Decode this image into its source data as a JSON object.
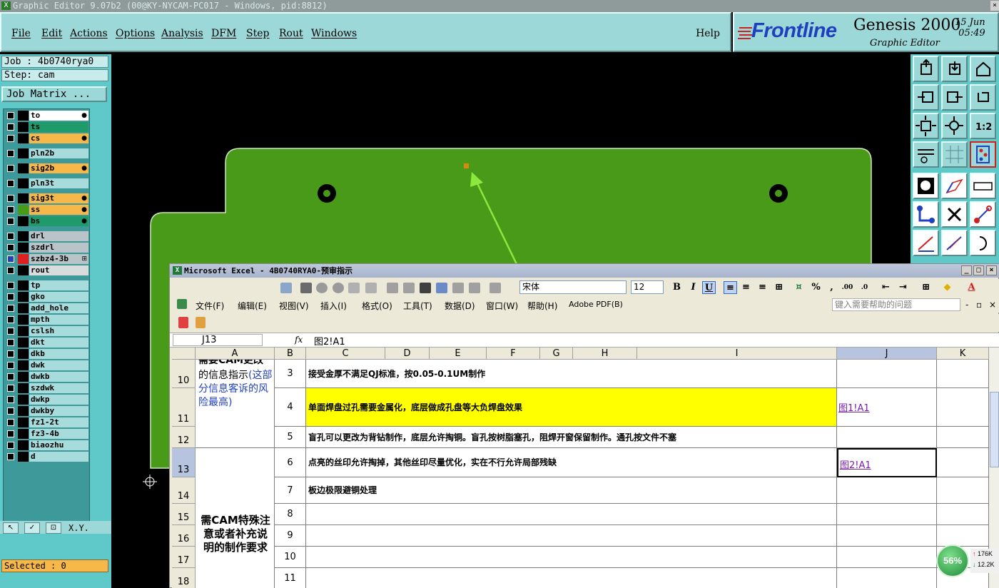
{
  "genesis": {
    "window_title": "Graphic Editor 9.07b2 (00@KY-NYCAM-PC017 - Windows, pid:8812)",
    "menu": [
      "File",
      "Edit",
      "Actions",
      "Options",
      "Analysis",
      "DFM",
      "Step",
      "Rout",
      "Windows"
    ],
    "help": "Help",
    "brand_logo": "Frontline",
    "brand_name": "Genesis 2000",
    "brand_sub": "Graphic Editor",
    "date": "15 Jun",
    "time": "05:49",
    "job": "Job : 4b0740rya0",
    "step": "Step: cam",
    "job_matrix": "Job Matrix ...",
    "selected": "Selected : 0",
    "layers": [
      {
        "name": "to",
        "color": "#ffffff",
        "mark": "●"
      },
      {
        "name": "ts",
        "color": "#1f9a6a",
        "mark": ""
      },
      {
        "name": "cs",
        "color": "#f7b84a",
        "mark": "●"
      },
      {
        "name": "pln2b",
        "color": "#a8dcdc",
        "mark": ""
      },
      {
        "name": "sig2b",
        "color": "#f7b84a",
        "mark": "●"
      },
      {
        "name": "pln3t",
        "color": "#a8dcdc",
        "mark": ""
      },
      {
        "name": "sig3t",
        "color": "#f7b84a",
        "mark": "●"
      },
      {
        "name": "ss",
        "color": "#f7b84a",
        "mark": "●"
      },
      {
        "name": "bs",
        "color": "#1f9a6a",
        "mark": "●"
      },
      {
        "name": "drl",
        "color": "#b8c4c8",
        "mark": ""
      },
      {
        "name": "szdrl",
        "color": "#b8c4c8",
        "mark": ""
      },
      {
        "name": "szbz4-3b",
        "color": "#b8c4c8",
        "mark": "⊞"
      },
      {
        "name": "rout",
        "color": "#d8dcdc",
        "mark": ""
      },
      {
        "name": "tp",
        "color": "#a8dcdc",
        "mark": ""
      },
      {
        "name": "gko",
        "color": "#a8dcdc",
        "mark": ""
      },
      {
        "name": "add_hole",
        "color": "#a8dcdc",
        "mark": ""
      },
      {
        "name": "mpth",
        "color": "#a8dcdc",
        "mark": ""
      },
      {
        "name": "cslsh",
        "color": "#a8dcdc",
        "mark": ""
      },
      {
        "name": "dkt",
        "color": "#a8dcdc",
        "mark": ""
      },
      {
        "name": "dkb",
        "color": "#a8dcdc",
        "mark": ""
      },
      {
        "name": "dwk",
        "color": "#a8dcdc",
        "mark": ""
      },
      {
        "name": "dwkb",
        "color": "#a8dcdc",
        "mark": ""
      },
      {
        "name": "szdwk",
        "color": "#a8dcdc",
        "mark": ""
      },
      {
        "name": "dwkp",
        "color": "#a8dcdc",
        "mark": ""
      },
      {
        "name": "dwkby",
        "color": "#a8dcdc",
        "mark": ""
      },
      {
        "name": "fz1-2t",
        "color": "#a8dcdc",
        "mark": ""
      },
      {
        "name": "fz3-4b",
        "color": "#a8dcdc",
        "mark": ""
      },
      {
        "name": "biaozhu",
        "color": "#a8dcdc",
        "mark": ""
      },
      {
        "name": "d",
        "color": "#a8dcdc",
        "mark": ""
      }
    ],
    "bottom_label": "X.Y."
  },
  "excel": {
    "title": "Microsoft Excel - 4B0740RYA0-预审指示",
    "font": "宋体",
    "size": "12",
    "menu": [
      "文件(F)",
      "编辑(E)",
      "视图(V)",
      "插入(I)",
      "格式(O)",
      "工具(T)",
      "数据(D)",
      "窗口(W)",
      "帮助(H)",
      "Adobe PDF(B)"
    ],
    "help_placeholder": "键入需要帮助的问题",
    "name_box": "J13",
    "fx": "fx",
    "formula": "图2!A1",
    "columns": [
      "A",
      "B",
      "C",
      "D",
      "E",
      "F",
      "G",
      "H",
      "I",
      "J",
      "K"
    ],
    "rows": [
      {
        "num": "10",
        "b": "3",
        "c": "接受金厚不满足QJ标准，按0.05-0.1UM制作",
        "j": ""
      },
      {
        "num": "11",
        "b": "4",
        "c": "单面焊盘过孔需要金属化，底层做成孔盘等大负焊盘效果",
        "j": "图1!A1"
      },
      {
        "num": "12",
        "b": "5",
        "c": "盲孔可以更改为背钻制作，底层允许掏铜。盲孔按树脂塞孔，阻焊开窗保留制作。通孔按文件不塞",
        "j": ""
      },
      {
        "num": "13",
        "b": "6",
        "c": "点亮的丝印允许掏掉，其他丝印尽量优化，实在不行允许局部残缺",
        "j": "图2!A1"
      },
      {
        "num": "14",
        "b": "7",
        "c": "板边极限避铜处理",
        "j": ""
      },
      {
        "num": "15",
        "b": "8",
        "c": "",
        "j": ""
      },
      {
        "num": "16",
        "b": "9",
        "c": "",
        "j": ""
      },
      {
        "num": "17",
        "b": "10",
        "c": "",
        "j": ""
      },
      {
        "num": "18",
        "b": "11",
        "c": "",
        "j": ""
      }
    ],
    "a_block1_top": "需要CAM更改",
    "a_block1_main": "的信息指示",
    "a_block1_blue": "(这部分信息客诉的风险最高)",
    "a_block2": "需CAM特殊注意或者补充说明的制作要求"
  },
  "net": {
    "percent": "56%",
    "up": "176K",
    "down": "12.2K"
  },
  "colors": {
    "board": "#4a9a1a",
    "arrow": "#8be83c",
    "highlight": "#ffff00",
    "genesis_bg": "#9cd8d8"
  }
}
